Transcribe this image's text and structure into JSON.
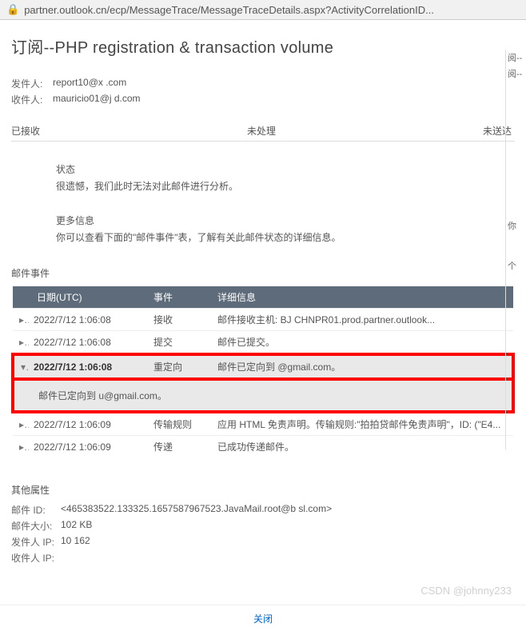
{
  "url": "partner.outlook.cn/ecp/MessageTrace/MessageTraceDetails.aspx?ActivityCorrelationID...",
  "title": "订阅--PHP registration & transaction volume",
  "fields": {
    "sender_label": "发件人:",
    "sender_value": "report10@x      .com",
    "recipient_label": "收件人:",
    "recipient_value": "mauricio01@j         d.com"
  },
  "status_tabs": [
    "已接收",
    "未处理",
    "未送达"
  ],
  "status_section": {
    "label": "状态",
    "body": "很遗憾，我们此时无法对此邮件进行分析。"
  },
  "more_section": {
    "label": "更多信息",
    "body": "你可以查看下面的\"邮件事件\"表，了解有关此邮件状态的详细信息。"
  },
  "events_heading": "邮件事件",
  "columns": [
    "日期(UTC)",
    "事件",
    "详细信息"
  ],
  "rows": [
    {
      "date": "2022/7/12 1:06:08",
      "event": "接收",
      "detail": "邮件接收主机: BJ            CHNPR01.prod.partner.outlook..."
    },
    {
      "date": "2022/7/12 1:06:08",
      "event": "提交",
      "detail": "邮件已提交。"
    },
    {
      "date": "2022/7/12 1:06:08",
      "event": "重定向",
      "detail": "邮件已定向到           @gmail.com。"
    },
    {
      "date": "2022/7/12 1:06:09",
      "event": "传输规则",
      "detail": "应用 HTML 免责声明。传输规则:\"拍拍贷邮件免责声明\"，ID: (\"E4..."
    },
    {
      "date": "2022/7/12 1:06:09",
      "event": "传递",
      "detail": "已成功传递邮件。"
    }
  ],
  "expanded_detail": "邮件已定向到          u@gmail.com。",
  "props_heading": "其他属性",
  "props": {
    "id_label": "邮件 ID:",
    "id_value": "<465383522.133325.1657587967523.JavaMail.root@b                  sl.com>",
    "size_label": "邮件大小:",
    "size_value": "102 KB",
    "sender_ip_label": "发件人 IP:",
    "sender_ip_value": "10          162",
    "recipient_ip_label": "收件人 IP:",
    "recipient_ip_value": ""
  },
  "watermark": "CSDN @johnny233",
  "footer": {
    "close": "关闭"
  },
  "side": {
    "a": "阅--",
    "b": "阅--",
    "c": "你",
    "d": "个"
  }
}
